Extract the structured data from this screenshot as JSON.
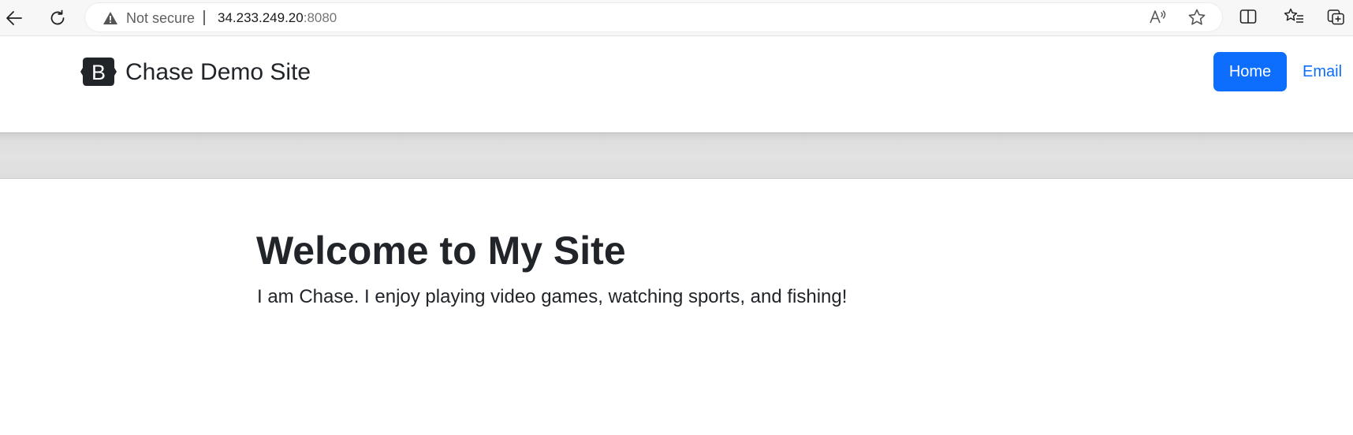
{
  "browser": {
    "security_label": "Not secure",
    "url_host": "34.233.249.20",
    "url_port": ":8080",
    "icons": {
      "back": "back-arrow-icon",
      "reload": "reload-icon",
      "warning": "warning-triangle-icon",
      "read_aloud": "read-aloud-icon",
      "favorite": "star-icon",
      "split_screen": "split-screen-icon",
      "favorites": "favorites-icon",
      "collections": "collections-icon"
    }
  },
  "site": {
    "brand_logo_letter": "B",
    "brand_name": "Chase Demo Site",
    "nav": {
      "home_label": "Home",
      "email_label": "Email"
    },
    "hero": {
      "title": "Welcome to My Site",
      "text": "I am Chase. I enjoy playing video games, watching sports, and fishing!"
    }
  },
  "colors": {
    "accent": "#0d6efd",
    "text": "#212529",
    "brand_logo_bg": "#212529"
  }
}
